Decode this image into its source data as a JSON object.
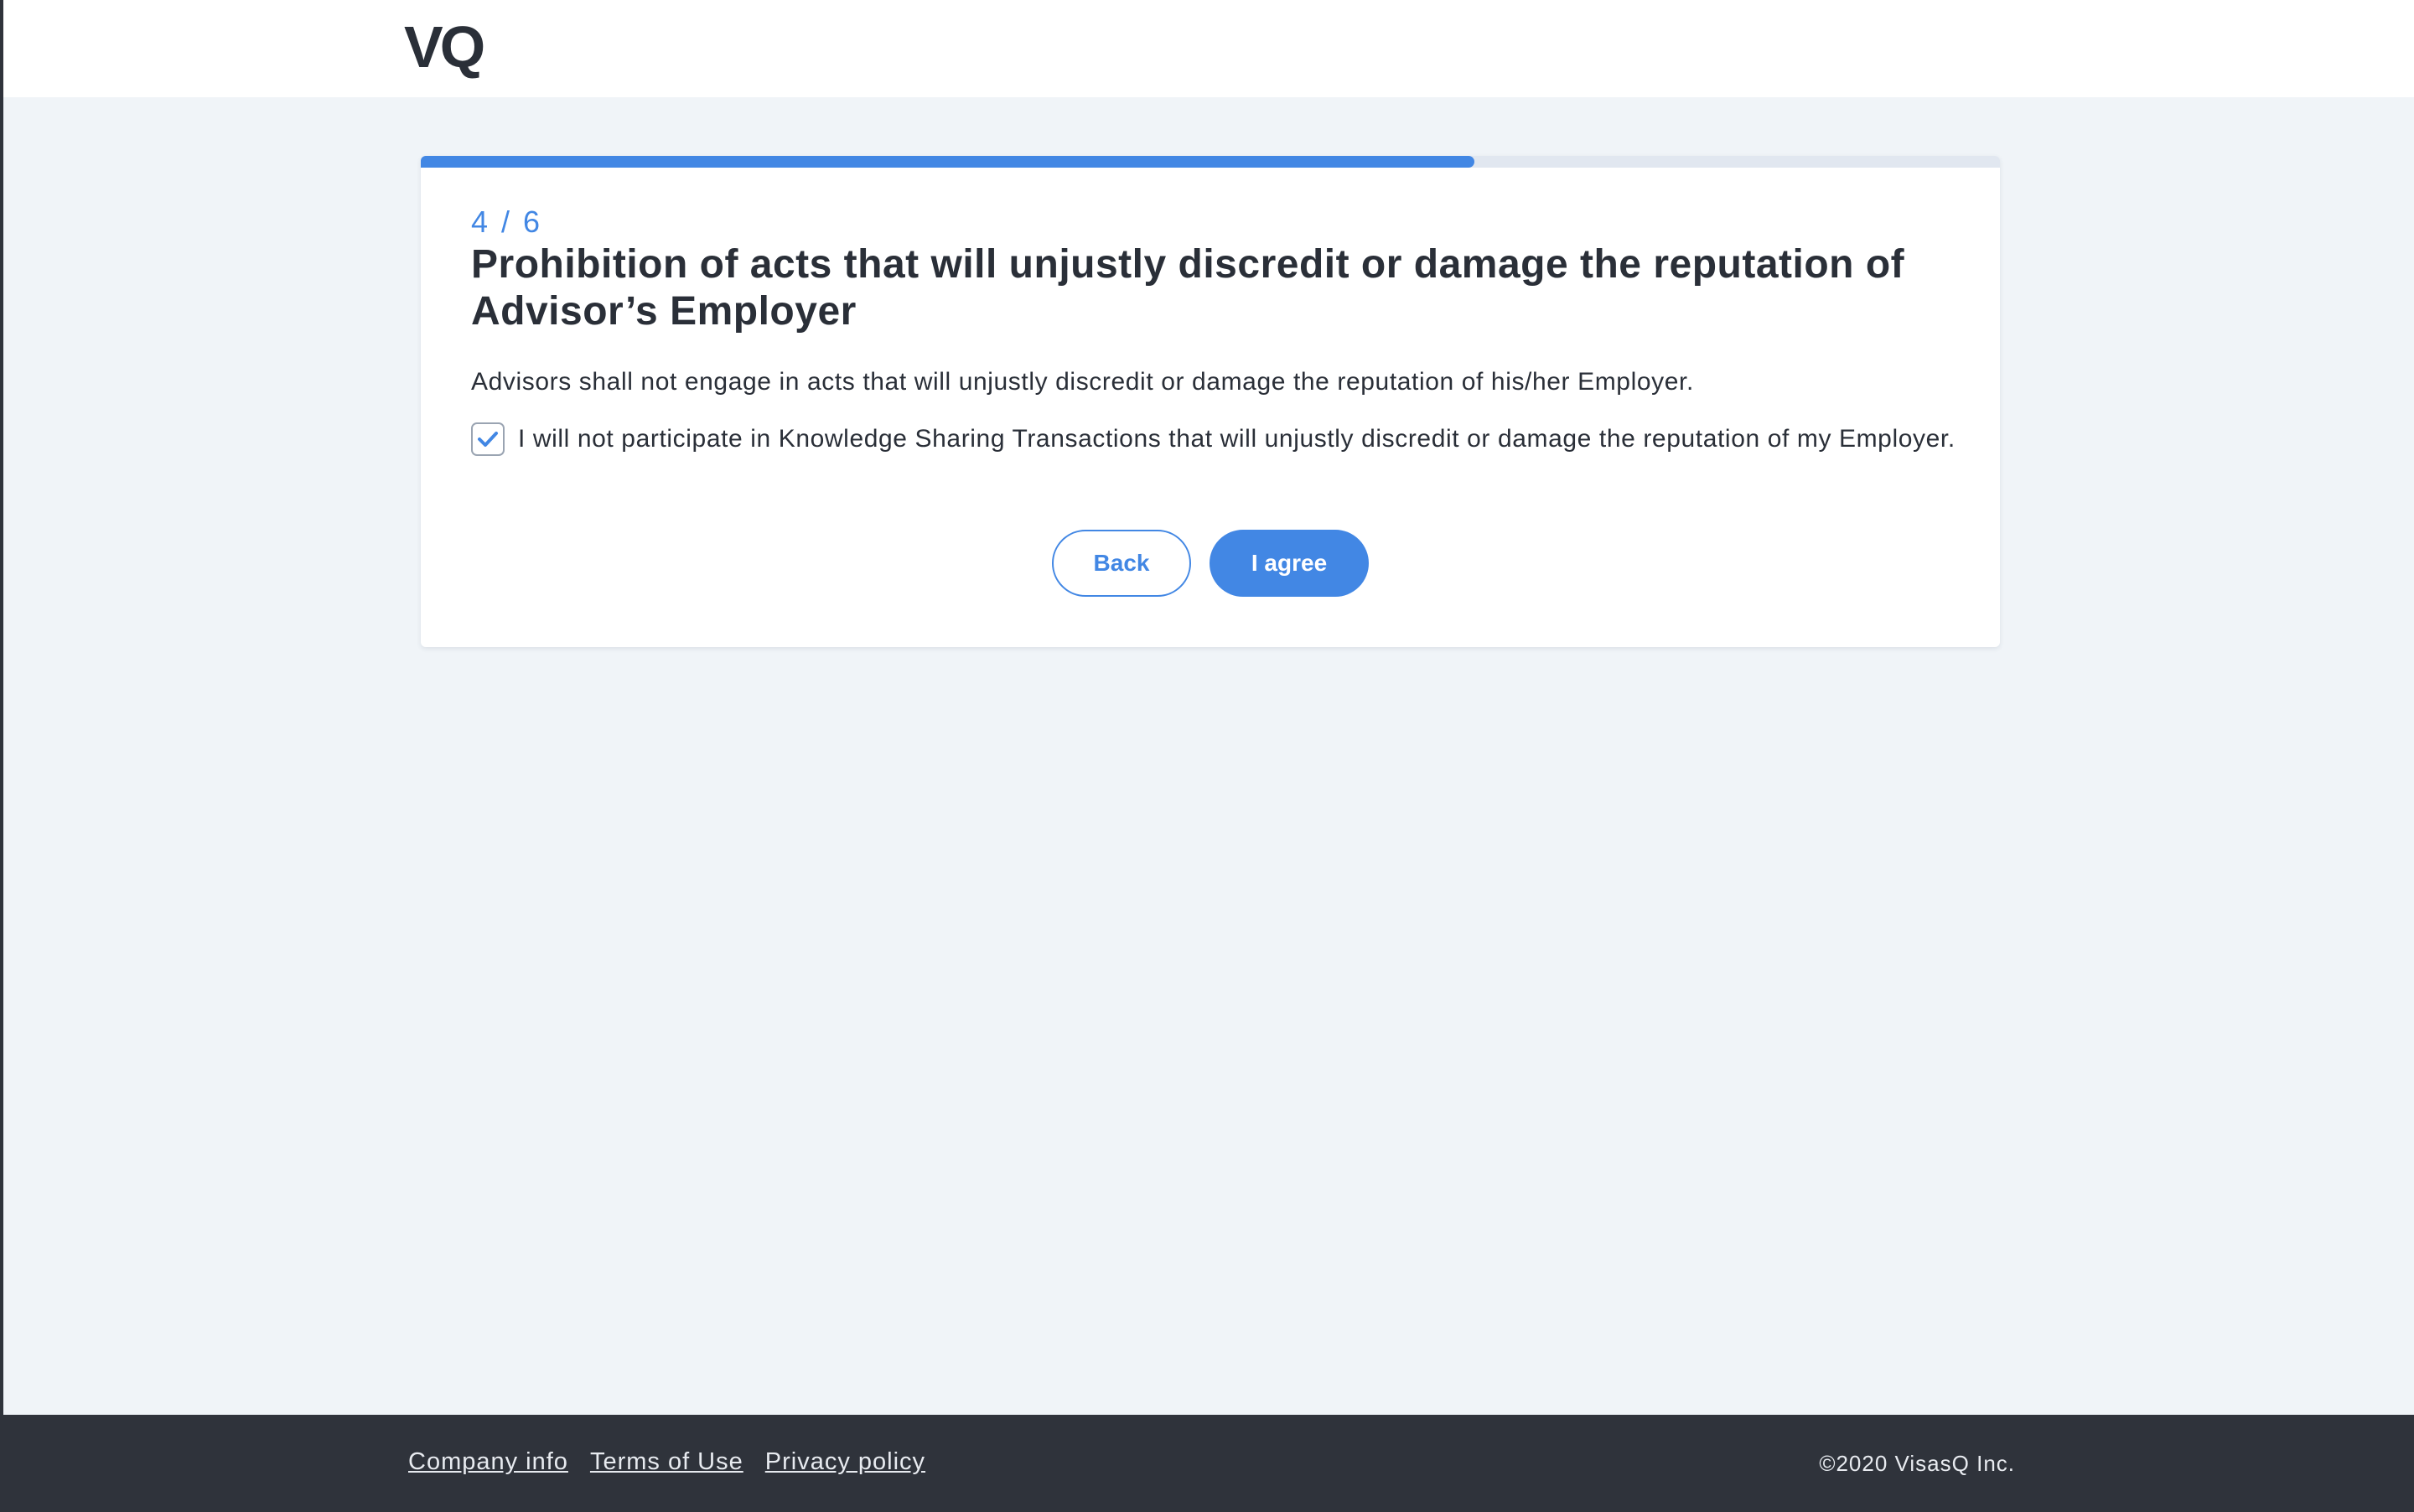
{
  "header": {
    "logo_text": "VQ"
  },
  "progress": {
    "current": 4,
    "total": 6,
    "fill_fraction": 0.667,
    "label": "4 / 6",
    "fill_color": "#4287e4"
  },
  "card": {
    "title": "Prohibition of acts that will unjustly discredit or damage the reputation of Advisor’s Employer",
    "description": "Advisors shall not engage in acts that will unjustly discredit or damage the reputation of his/her Employer.",
    "checkbox": {
      "checked": true,
      "label": "I will not participate in Knowledge Sharing Transactions that will unjustly discredit or damage the reputation of my Employer."
    }
  },
  "actions": {
    "back_label": "Back",
    "agree_label": "I agree"
  },
  "footer": {
    "links": [
      "Company info",
      "Terms of Use",
      "Privacy policy"
    ],
    "copyright": "©2020 VisasQ Inc."
  },
  "colors": {
    "accent": "#4287e4",
    "footer_bg": "#2f333b",
    "page_bg": "#f0f4f8"
  },
  "icons": {
    "checkbox": "check-icon"
  }
}
